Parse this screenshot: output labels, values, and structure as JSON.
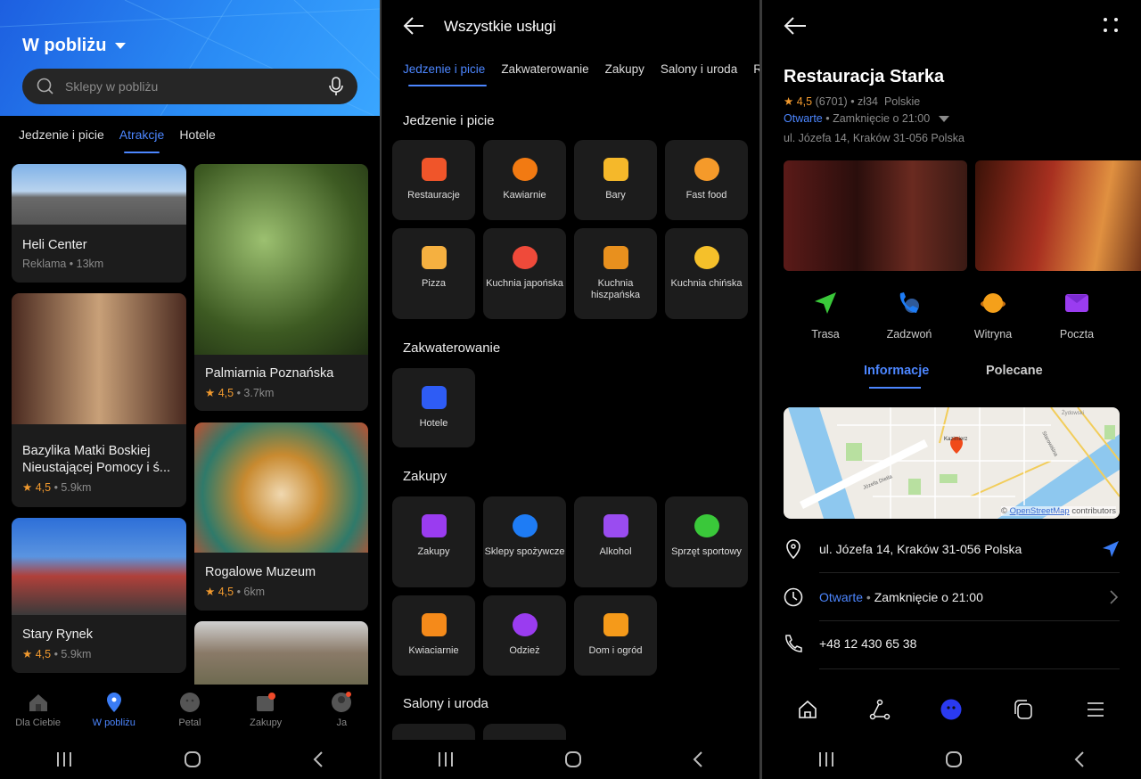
{
  "colors": {
    "accent": "#4c86ff",
    "star": "#f29a2e",
    "tile_bg": "#1c1c1c"
  },
  "left": {
    "header": {
      "title": "W pobliżu",
      "search_placeholder": "Sklepy w pobliżu"
    },
    "tabs": [
      {
        "label": "Jedzenie i picie",
        "active": false
      },
      {
        "label": "Atrakcje",
        "active": true
      },
      {
        "label": "Hotele",
        "active": false
      }
    ],
    "cards": [
      {
        "title": "Heli Center",
        "meta_prefix": "Reklama",
        "distance": "13km"
      },
      {
        "title": "Bazylika Matki Boskiej Nieustającej Pomocy i ś...",
        "rating": "4,5",
        "distance": "5.9km"
      },
      {
        "title": "Stary Rynek",
        "rating": "4,5",
        "distance": "5.9km"
      },
      {
        "title": "Palmiarnia Poznańska",
        "rating": "4,5",
        "distance": "3.7km"
      },
      {
        "title": "Rogalowe Muzeum",
        "rating": "4,5",
        "distance": "6km"
      }
    ],
    "bottom_nav": [
      {
        "label": "Dla Ciebie",
        "icon": "home-icon"
      },
      {
        "label": "W pobliżu",
        "icon": "location-pin-icon",
        "active": true
      },
      {
        "label": "Petal",
        "icon": "petal-icon"
      },
      {
        "label": "Zakupy",
        "icon": "shopping-bag-icon"
      },
      {
        "label": "Ja",
        "icon": "profile-icon"
      }
    ]
  },
  "middle": {
    "title": "Wszystkie usługi",
    "tabs": [
      {
        "label": "Jedzenie i picie",
        "active": true
      },
      {
        "label": "Zakwaterowanie"
      },
      {
        "label": "Zakupy"
      },
      {
        "label": "Salony i uroda"
      },
      {
        "label": "R"
      }
    ],
    "sections": [
      {
        "title": "Jedzenie i picie",
        "items": [
          {
            "label": "Restauracje",
            "icon": "fork-spoon-icon",
            "color": "#f0552a"
          },
          {
            "label": "Kawiarnie",
            "icon": "coffee-cup-icon",
            "color": "#f27a12"
          },
          {
            "label": "Bary",
            "icon": "beer-mug-icon",
            "color": "#f5b82a"
          },
          {
            "label": "Fast food",
            "icon": "fast-food-icon",
            "color": "#f59a2a"
          },
          {
            "label": "Pizza",
            "icon": "pizza-icon",
            "color": "#f5b040"
          },
          {
            "label": "Kuchnia japońska",
            "icon": "sushi-icon",
            "color": "#ef4a3a"
          },
          {
            "label": "Kuchnia hiszpańska",
            "icon": "paella-icon",
            "color": "#e8901e"
          },
          {
            "label": "Kuchnia chińska",
            "icon": "dumpling-icon",
            "color": "#f5c02a"
          }
        ]
      },
      {
        "title": "Zakwaterowanie",
        "items": [
          {
            "label": "Hotele",
            "icon": "hotel-icon",
            "color": "#2e5cf5"
          }
        ]
      },
      {
        "title": "Zakupy",
        "items": [
          {
            "label": "Zakupy",
            "icon": "shopping-bag-icon",
            "color": "#9a3cf0"
          },
          {
            "label": "Sklepy spożywcze",
            "icon": "cart-icon",
            "color": "#1e7cf5"
          },
          {
            "label": "Alkohol",
            "icon": "bottle-icon",
            "color": "#9a4cf0"
          },
          {
            "label": "Sprzęt sportowy",
            "icon": "dumbbell-icon",
            "color": "#3ac83a"
          },
          {
            "label": "Kwiaciarnie",
            "icon": "flower-icon",
            "color": "#f58a1a"
          },
          {
            "label": "Odzież",
            "icon": "tshirt-icon",
            "color": "#9a3cf0"
          },
          {
            "label": "Dom i ogród",
            "icon": "armchair-icon",
            "color": "#f59a1a"
          }
        ]
      },
      {
        "title": "Salony i uroda",
        "items": []
      }
    ]
  },
  "right": {
    "title": "Restauracja Starka",
    "rating": "4,5",
    "reviews": "(6701)",
    "price": "zł34",
    "cuisine": "Polskie",
    "status": "Otwarte",
    "closing": "Zamknięcie o 21:00",
    "address": "ul. Józefa 14, Kraków 31-056 Polska",
    "actions": [
      {
        "label": "Trasa",
        "icon": "directions-icon",
        "color": "#3ac83a"
      },
      {
        "label": "Zadzwoń",
        "icon": "phone-icon",
        "color": "#1e7cf5"
      },
      {
        "label": "Witryna",
        "icon": "website-planet-icon",
        "color": "#f5a01a"
      },
      {
        "label": "Poczta",
        "icon": "mail-icon",
        "color": "#9a3cf0"
      }
    ],
    "tabs": [
      {
        "label": "Informacje",
        "active": true
      },
      {
        "label": "Polecane"
      }
    ],
    "map": {
      "district": "Kazimierz",
      "street1": "Józefa Dietla",
      "street2": "Starowiślna",
      "area": "Żydowski",
      "attribution_prefix": "©",
      "attribution_link": "OpenStreetMap",
      "attribution_suffix": "contributors"
    },
    "info_rows": {
      "address": "ul. Józefa 14, Kraków 31-056 Polska",
      "status": "Otwarte",
      "closing": "Zamknięcie o 21:00",
      "phone": "+48 12 430 65 38"
    }
  }
}
